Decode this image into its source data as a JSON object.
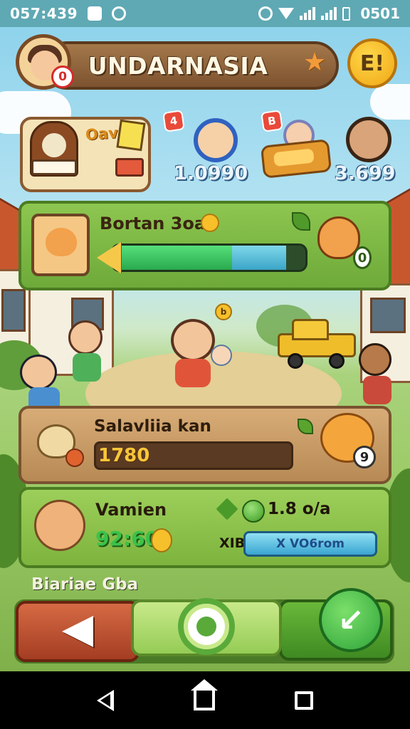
{
  "status_bar": {
    "time": "057:439",
    "right_time": "0501"
  },
  "header": {
    "title": "UNDARNASIA",
    "avatar_badge": "0",
    "alert_label": "E!"
  },
  "resources": {
    "book_label": "Oav",
    "items": [
      {
        "badge": "4",
        "value": "1.0990"
      },
      {
        "badge": "B",
        "value": ""
      },
      {
        "badge": "",
        "value": "3.699"
      }
    ]
  },
  "quest": {
    "title": "Bortan 3oa",
    "count": "0",
    "progress": 0.62,
    "secondary_progress": 0.9
  },
  "scene": {
    "coin_label": "b"
  },
  "harvest": {
    "title": "Salavliia kan",
    "value": "1780",
    "count": "9"
  },
  "pet": {
    "name": "Vamien",
    "value": "92:60",
    "stat": "1.8 o/a",
    "tag": "XIB",
    "bar_label": "X VO6rom"
  },
  "section": {
    "title": "Biariae Gba"
  },
  "colors": {
    "accent_green": "#6eaa3a",
    "panel_brown": "#b78a55",
    "back_red": "#a43d22",
    "sky": "#8fd3ec"
  }
}
